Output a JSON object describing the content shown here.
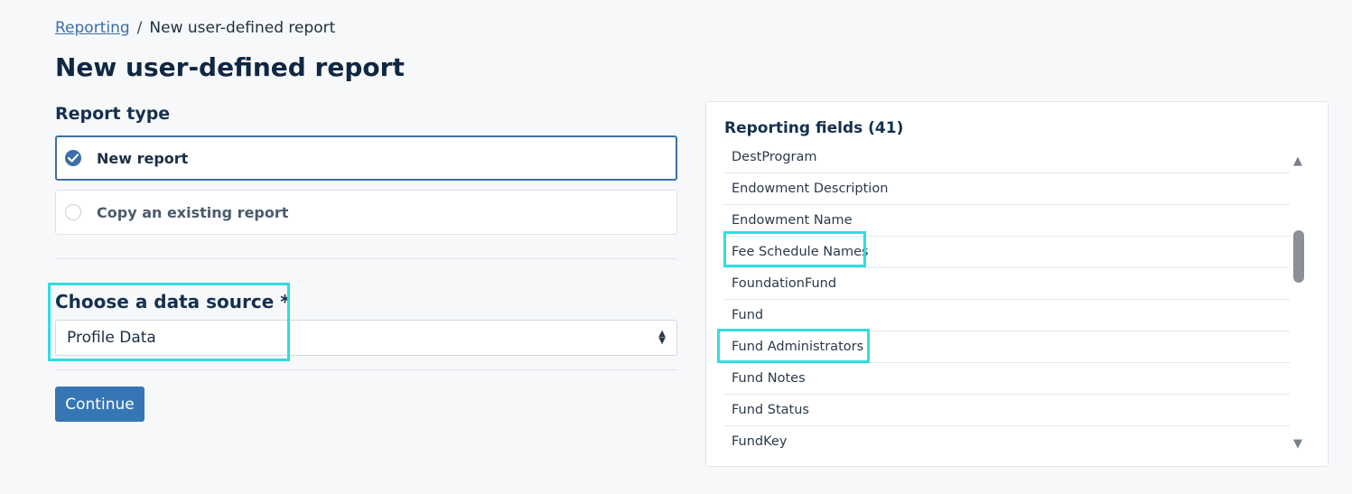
{
  "breadcrumb": {
    "parent": "Reporting",
    "separator": "/",
    "current": "New user-defined report"
  },
  "page_title": "New user-defined report",
  "report_type": {
    "label": "Report type",
    "options": [
      {
        "label": "New report",
        "selected": true
      },
      {
        "label": "Copy an existing report",
        "selected": false
      }
    ]
  },
  "data_source": {
    "label": "Choose a data source *",
    "value": "Profile Data",
    "arrows": "▲▼"
  },
  "continue_label": "Continue",
  "reporting_fields": {
    "title": "Reporting fields (41)",
    "items": [
      "DestProgram",
      "Endowment Description",
      "Endowment Name",
      "Fee Schedule Names",
      "FoundationFund",
      "Fund",
      "Fund Administrators",
      "Fund Notes",
      "Fund Status",
      "FundKey"
    ]
  },
  "colors": {
    "accent": "#3b6fa6",
    "button": "#3676b5",
    "highlight": "#2fdde0"
  }
}
